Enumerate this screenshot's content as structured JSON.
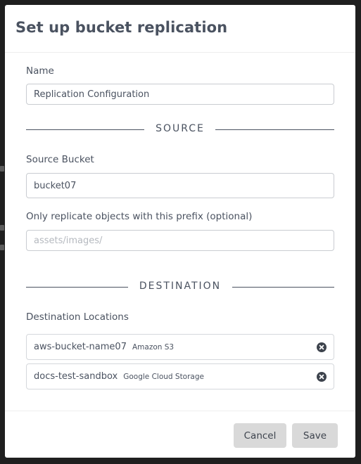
{
  "dialog": {
    "title": "Set up bucket replication"
  },
  "name_field": {
    "label": "Name",
    "value": "Replication Configuration"
  },
  "source_section": {
    "heading": "SOURCE",
    "bucket_label": "Source Bucket",
    "bucket_value": "bucket07",
    "prefix_label": "Only replicate objects with this prefix (optional)",
    "prefix_value": "",
    "prefix_placeholder": "assets/images/"
  },
  "destination_section": {
    "heading": "DESTINATION",
    "locations_label": "Destination Locations",
    "locations": [
      {
        "name": "aws-bucket-name07",
        "provider": "Amazon S3",
        "remove_icon": "close-circle-icon"
      },
      {
        "name": "docs-test-sandbox",
        "provider": "Google Cloud Storage",
        "remove_icon": "close-circle-icon"
      }
    ]
  },
  "footer": {
    "cancel_label": "Cancel",
    "save_label": "Save"
  },
  "colors": {
    "backdrop": "#1f1f1f",
    "text": "#4a5260",
    "button_bg": "#d9d9d9",
    "input_border": "#c9ccd1"
  }
}
